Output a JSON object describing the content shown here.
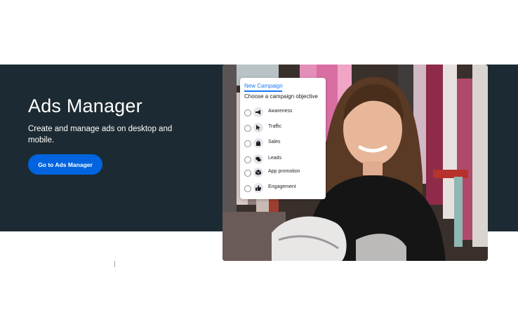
{
  "hero": {
    "title": "Ads Manager",
    "description": "Create and manage ads on desktop and mobile.",
    "cta_label": "Go to Ads Manager",
    "band_color": "#1c2b33",
    "cta_color": "#0064e0"
  },
  "campaign_card": {
    "tab_label": "New Campaign",
    "heading": "Choose a campaign objective",
    "objectives": [
      {
        "label": "Awareness",
        "icon": "megaphone-icon"
      },
      {
        "label": "Traffic",
        "icon": "cursor-icon"
      },
      {
        "label": "Sales",
        "icon": "shopping-bag-icon"
      },
      {
        "label": "Leads",
        "icon": "chat-bubbles-icon"
      },
      {
        "label": "App promotion",
        "icon": "cube-icon"
      },
      {
        "label": "Engagement",
        "icon": "thumbs-up-icon"
      }
    ]
  }
}
